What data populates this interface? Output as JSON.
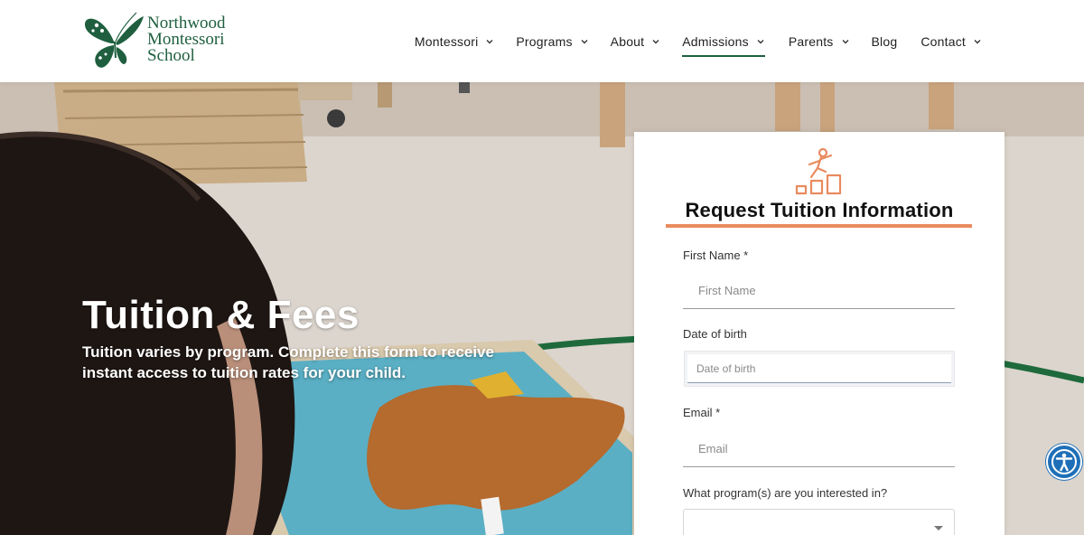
{
  "brand": {
    "name_lines": [
      "Northwood",
      "Montessori",
      "School"
    ],
    "green": "#1f5f3f"
  },
  "nav": {
    "items": [
      {
        "label": "Montessori",
        "has_dropdown": true,
        "active": false
      },
      {
        "label": "Programs",
        "has_dropdown": true,
        "active": false
      },
      {
        "label": "About",
        "has_dropdown": true,
        "active": false
      },
      {
        "label": "Admissions",
        "has_dropdown": true,
        "active": true
      },
      {
        "label": "Parents",
        "has_dropdown": true,
        "active": false
      },
      {
        "label": "Blog",
        "has_dropdown": false,
        "active": false
      },
      {
        "label": "Contact",
        "has_dropdown": true,
        "active": false
      }
    ]
  },
  "hero": {
    "title": "Tuition & Fees",
    "subtitle": "Tuition varies by program. Complete this form to receive instant access to tuition rates for your child."
  },
  "form": {
    "icon": "climbing-steps-icon",
    "title": "Request Tuition Information",
    "accent": "#e98b5f",
    "first_name": {
      "label": "First Name *",
      "placeholder": "First Name",
      "value": ""
    },
    "dob": {
      "label": "Date of birth",
      "placeholder": "Date of birth",
      "value": ""
    },
    "email": {
      "label": "Email *",
      "placeholder": "Email",
      "value": ""
    },
    "program": {
      "label": "What program(s) are you interested in?",
      "value": ""
    }
  },
  "accessibility": {
    "icon": "accessibility-icon",
    "color": "#1e6fb8"
  }
}
